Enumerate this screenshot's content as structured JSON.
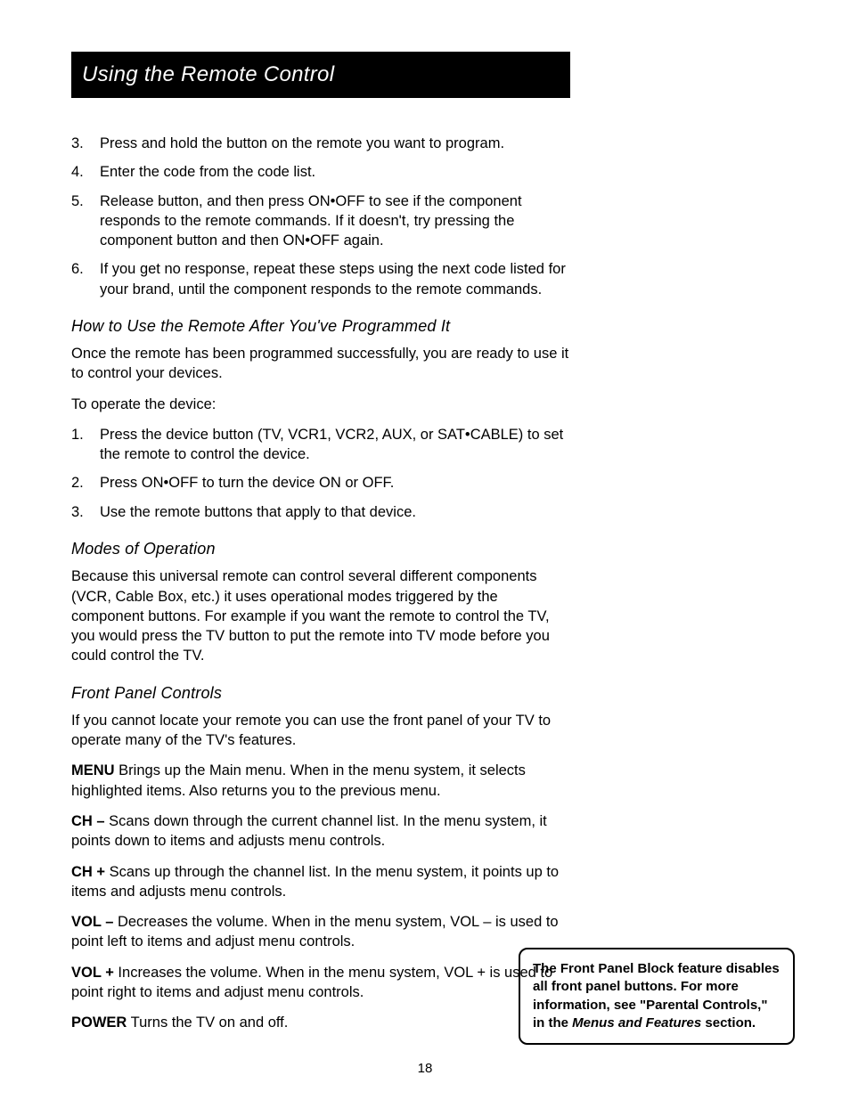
{
  "header": {
    "title": "Using the Remote Control"
  },
  "continuedSteps": [
    {
      "num": "3.",
      "text": "Press and hold the button on the remote you want to program."
    },
    {
      "num": "4.",
      "text": "Enter the code from the code list."
    },
    {
      "num": "5.",
      "text": "Release button, and then press ON•OFF to see if the component responds to the remote commands. If it doesn't, try pressing the component button and then ON•OFF again."
    },
    {
      "num": "6.",
      "text": "If you get no response, repeat these steps using the next code listed for your brand, until the component responds to the remote commands."
    }
  ],
  "operate": {
    "heading": "How to Use the Remote After You've Programmed It",
    "intro": "Once the remote has been programmed successfully, you are ready to use it to control your devices.",
    "lead": "To operate the device:",
    "steps": [
      {
        "num": "1.",
        "text": "Press the device button (TV, VCR1, VCR2, AUX, or SAT•CABLE) to set the remote to control the device."
      },
      {
        "num": "2.",
        "text": "Press ON•OFF to turn the device ON or OFF."
      },
      {
        "num": "3.",
        "text": "Use the remote buttons that apply to that device."
      }
    ]
  },
  "modes": {
    "heading": "Modes of Operation",
    "para": "Because this universal remote can control several different components (VCR, Cable Box, etc.) it uses operational modes triggered by the component buttons. For example if you want the remote to control the TV, you would press the TV button to put the remote into TV mode before you could control the TV."
  },
  "panel": {
    "heading": "Front Panel Controls",
    "intro": "If you cannot locate your remote you can use the front panel of your TV to operate many of the TV's features.",
    "items": [
      {
        "label": "MENU",
        "desc": " Brings up the Main menu. When in the menu system, it selects highlighted items. Also returns you to the previous menu."
      },
      {
        "label": "CH –",
        "desc": "  Scans down through the current channel list. In the menu system, it points down to items and adjusts menu controls."
      },
      {
        "label": "CH +",
        "desc": "  Scans up through the channel list. In the menu system, it points up to items and adjusts menu controls."
      },
      {
        "label": "VOL – ",
        "desc": "Decreases the volume. When in the menu system, VOL – is used to point left to items and adjust menu controls."
      },
      {
        "label": "VOL +",
        "desc": "  Increases the volume. When in the menu system, VOL + is used to point right to items and adjust menu controls."
      },
      {
        "label": "POWER",
        "desc": "  Turns the TV on and off."
      }
    ]
  },
  "noteBox": {
    "textBefore": "The Front Panel Block feature disables all front panel buttons. For more information, see \"Parental Controls,\" in the ",
    "italic": "Menus and Features",
    "textAfter": " section."
  },
  "pageNumber": "18"
}
